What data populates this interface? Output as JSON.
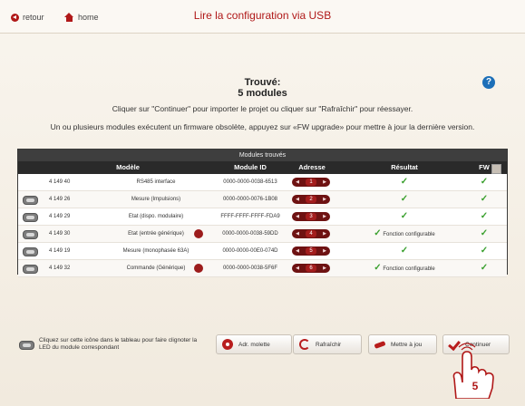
{
  "topbar": {
    "back_label": "retour",
    "home_label": "home",
    "title": "Lire la configuration via USB"
  },
  "status": {
    "found_line1": "Trouvé:",
    "found_line2": "5 modules",
    "instruction": "Cliquer sur \"Continuer\" pour importer le projet ou cliquer sur \"Rafraîchir\" pour réessayer.",
    "warning": "Un ou plusieurs modules exécutent un firmware obsolète, appuyez sur «FW upgrade» pour mettre à jour la dernière version."
  },
  "table": {
    "caption": "Modules trouvés",
    "headers": {
      "model": "Modèle",
      "module_id": "Module ID",
      "address": "Adresse",
      "result": "Résultat",
      "fw": "FW"
    },
    "rows": [
      {
        "ref": "4 149 40",
        "name": "RS485 interface",
        "module_id": "0000-0000-0038-6513",
        "address": "1",
        "result": "",
        "led": false,
        "warn": false
      },
      {
        "ref": "4 149 26",
        "name": "Mesure (Impulsions)",
        "module_id": "0000-0000-0076-1B08",
        "address": "2",
        "result": "",
        "led": true,
        "warn": false
      },
      {
        "ref": "4 149 29",
        "name": "Etat (dispo. modulaire)",
        "module_id": "FFFF-FFFF-FFFF-FDA9",
        "address": "3",
        "result": "",
        "led": true,
        "warn": false
      },
      {
        "ref": "4 149 30",
        "name": "Etat (entrée générique)",
        "module_id": "0000-0000-0038-59DD",
        "address": "4",
        "result": "Fonction configurable",
        "led": true,
        "warn": true
      },
      {
        "ref": "4 149 19",
        "name": "Mesure (monophasée 63A)",
        "module_id": "0000-0000-00E0-074D",
        "address": "5",
        "result": "",
        "led": true,
        "warn": false
      },
      {
        "ref": "4 149 32",
        "name": "Commande (Générique)",
        "module_id": "0000-0000-0038-5F6F",
        "address": "6",
        "result": "Fonction configurable",
        "led": true,
        "warn": true
      }
    ]
  },
  "legend": {
    "text": "Cliquez sur cette icône dans le tableau pour faire clignoter la LED du module correspondant"
  },
  "buttons": {
    "wheel": "Adr. molette",
    "refresh": "Rafraîchir",
    "fw_upgrade": "Mettre à jou",
    "continue": "Continuer"
  },
  "annotation": {
    "step": "5"
  },
  "colors": {
    "accent": "#b01818",
    "ok": "#3aa02e",
    "header": "#2a2a2a"
  }
}
